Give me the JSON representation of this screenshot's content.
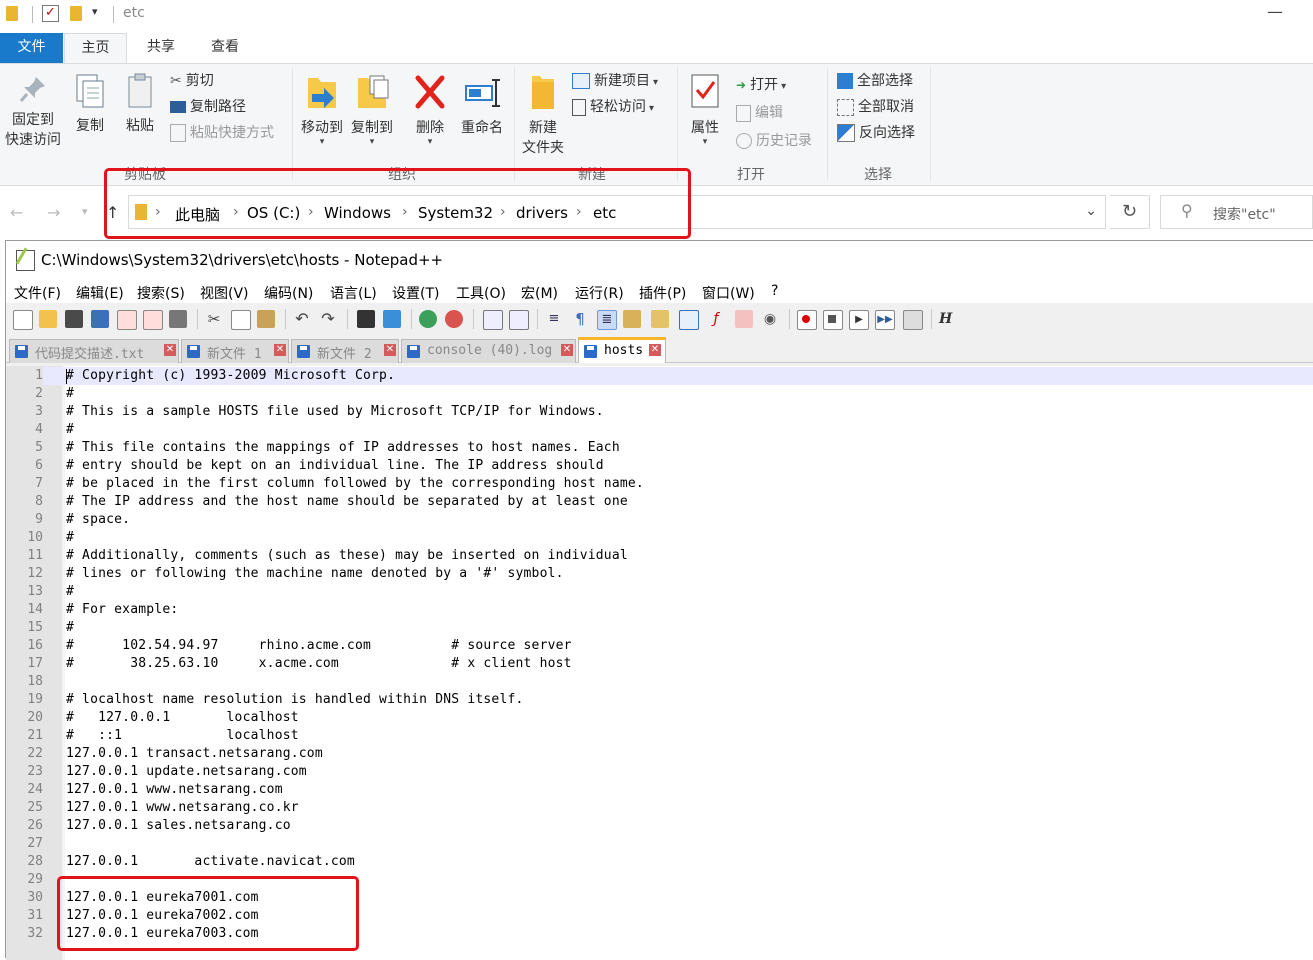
{
  "explorer": {
    "title": "etc",
    "ribbon_tabs": [
      "文件",
      "主页",
      "共享",
      "查看"
    ],
    "clipboard": {
      "pin_line1": "固定到",
      "pin_line2": "快速访问",
      "copy": "复制",
      "paste": "粘贴",
      "cut": "剪切",
      "copy_path": "复制路径",
      "paste_shortcut": "粘贴快捷方式",
      "group": "剪贴板"
    },
    "organize": {
      "move_to": "移动到",
      "copy_to": "复制到",
      "delete": "删除",
      "rename": "重命名",
      "group": "组织"
    },
    "new": {
      "new_folder_line1": "新建",
      "new_folder_line2": "文件夹",
      "new_item": "新建项目",
      "easy_access": "轻松访问",
      "group": "新建"
    },
    "open": {
      "properties": "属性",
      "open": "打开",
      "edit": "编辑",
      "history": "历史记录",
      "group": "打开"
    },
    "select": {
      "select_all": "全部选择",
      "select_none": "全部取消",
      "invert": "反向选择",
      "group": "选择"
    },
    "breadcrumbs": [
      "此电脑",
      "OS (C:)",
      "Windows",
      "System32",
      "drivers",
      "etc"
    ],
    "search_placeholder": "搜索\"etc\""
  },
  "notepad": {
    "title": "C:\\Windows\\System32\\drivers\\etc\\hosts - Notepad++",
    "menu": [
      "文件(F)",
      "编辑(E)",
      "搜索(S)",
      "视图(V)",
      "编码(N)",
      "语言(L)",
      "设置(T)",
      "工具(O)",
      "宏(M)",
      "运行(R)",
      "插件(P)",
      "窗口(W)",
      "?"
    ],
    "tabs": [
      {
        "label": "代码提交描述.txt"
      },
      {
        "label": "新文件 1"
      },
      {
        "label": "新文件 2"
      },
      {
        "label": "console (40).log"
      },
      {
        "label": "hosts"
      }
    ],
    "lines": [
      "# Copyright (c) 1993-2009 Microsoft Corp.",
      "#",
      "# This is a sample HOSTS file used by Microsoft TCP/IP for Windows.",
      "#",
      "# This file contains the mappings of IP addresses to host names. Each",
      "# entry should be kept on an individual line. The IP address should",
      "# be placed in the first column followed by the corresponding host name.",
      "# The IP address and the host name should be separated by at least one",
      "# space.",
      "#",
      "# Additionally, comments (such as these) may be inserted on individual",
      "# lines or following the machine name denoted by a '#' symbol.",
      "#",
      "# For example:",
      "#",
      "#      102.54.94.97     rhino.acme.com          # source server",
      "#       38.25.63.10     x.acme.com              # x client host",
      "",
      "# localhost name resolution is handled within DNS itself.",
      "#   127.0.0.1       localhost",
      "#   ::1             localhost",
      "127.0.0.1 transact.netsarang.com",
      "127.0.0.1 update.netsarang.com",
      "127.0.0.1 www.netsarang.com",
      "127.0.0.1 www.netsarang.co.kr",
      "127.0.0.1 sales.netsarang.co",
      "",
      "127.0.0.1       activate.navicat.com",
      "",
      "127.0.0.1 eureka7001.com",
      "127.0.0.1 eureka7002.com",
      "127.0.0.1 eureka7003.com"
    ],
    "line_numbers": [
      "1",
      "2",
      "3",
      "4",
      "5",
      "6",
      "7",
      "8",
      "9",
      "10",
      "11",
      "12",
      "13",
      "14",
      "15",
      "16",
      "17",
      "18",
      "19",
      "20",
      "21",
      "22",
      "23",
      "24",
      "25",
      "26",
      "27",
      "28",
      "29",
      "30",
      "31",
      "32"
    ]
  }
}
